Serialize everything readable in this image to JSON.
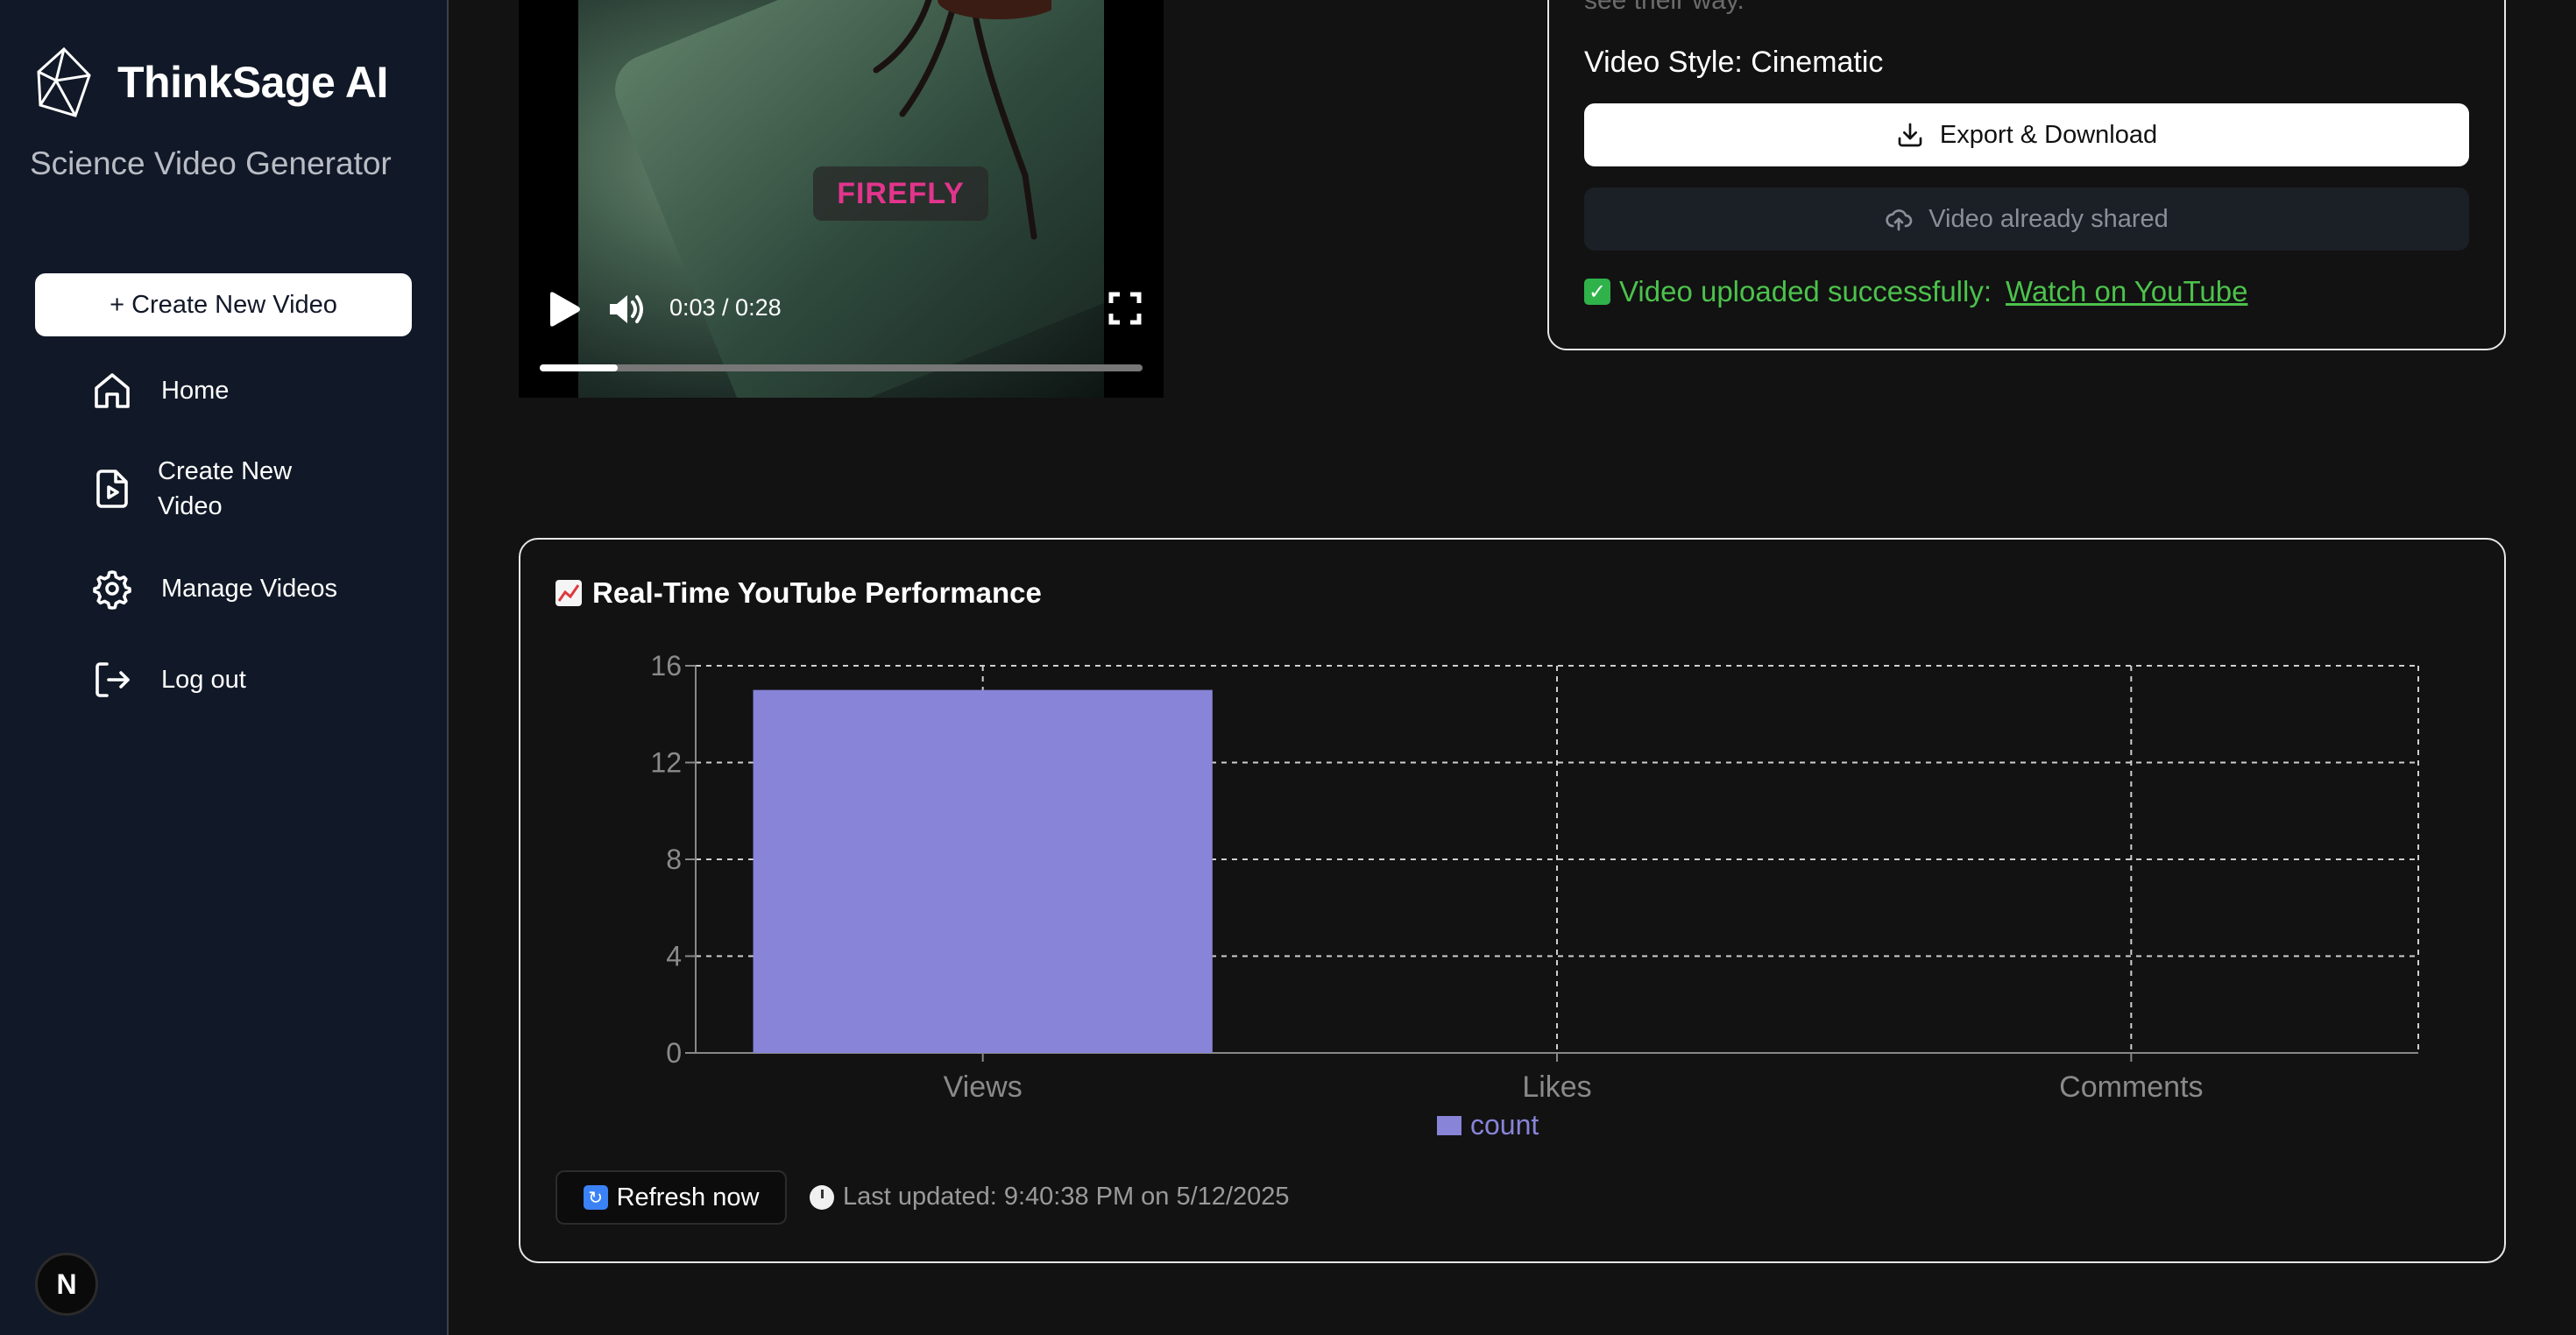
{
  "sidebar": {
    "brand": "ThinkSage AI",
    "subtitle": "Science Video Generator",
    "create_button": "+ Create New Video",
    "items": [
      {
        "label": "Home",
        "icon": "home-icon"
      },
      {
        "label": "Create New Video",
        "icon": "file-video-icon"
      },
      {
        "label": "Manage Videos",
        "icon": "gear-icon"
      },
      {
        "label": "Log out",
        "icon": "logout-icon"
      }
    ],
    "badge": "N"
  },
  "video": {
    "overlay_label": "FIREFLY",
    "time": "0:03 / 0:28",
    "progress": 0.13
  },
  "details": {
    "faded_text": "see their way.",
    "style_line": "Video Style: Cinematic",
    "export_label": "Export & Download",
    "shared_label": "Video already shared",
    "upload_message": "Video uploaded successfully:",
    "upload_link": "Watch on YouTube",
    "success_color": "#4cc24c"
  },
  "performance": {
    "title": "Real-Time YouTube Performance",
    "refresh_label": "Refresh now",
    "last_updated": "Last updated: 9:40:38 PM on 5/12/2025"
  },
  "chart_data": {
    "type": "bar",
    "title": "Real-Time YouTube Performance",
    "categories": [
      "Views",
      "Likes",
      "Comments"
    ],
    "series": [
      {
        "name": "count",
        "values": [
          15,
          0,
          0
        ],
        "color": "#8884d8"
      }
    ],
    "ylim": [
      0,
      16
    ],
    "yticks": [
      0,
      4,
      8,
      12,
      16
    ],
    "grid": true,
    "legend": "bottom",
    "xlabel": "",
    "ylabel": ""
  }
}
